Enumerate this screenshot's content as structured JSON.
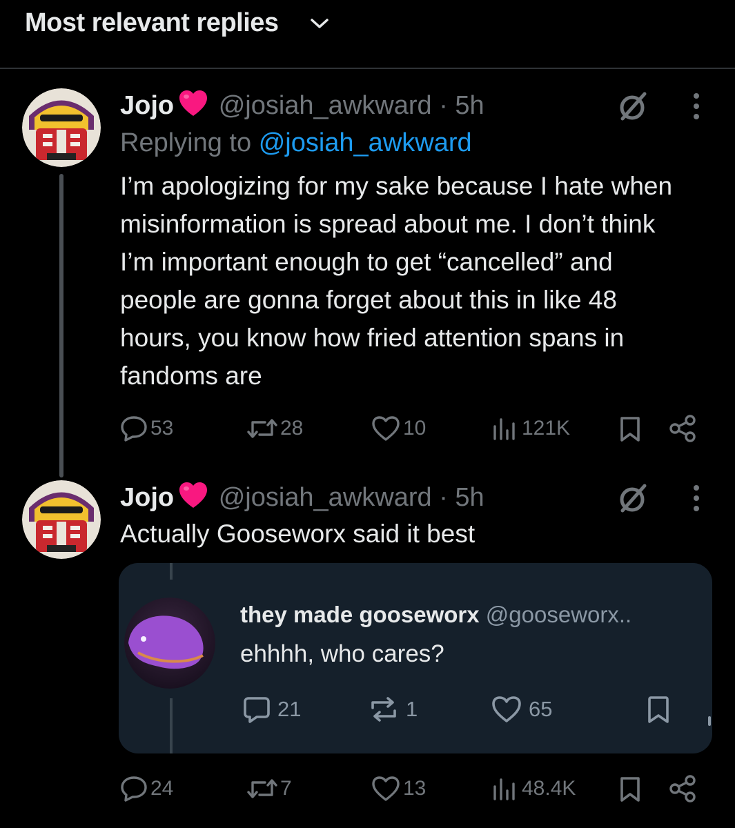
{
  "header": {
    "title": "Most relevant replies",
    "dropdown_icon": "chevron-down-icon"
  },
  "colors": {
    "background": "#000000",
    "text": "#e7e9ea",
    "muted": "#71767b",
    "link": "#1d9bf0",
    "heart": "#f91880",
    "quote_bg": "#15202b"
  },
  "tweets": [
    {
      "name": "Jojo",
      "handle": "@josiah_awkward",
      "separator": "·",
      "time": "5h",
      "replying_prefix": "Replying to",
      "replying_to": "@josiah_awkward",
      "text": "I’m apologizing for my sake because I hate when misinformation is spread about me. I don’t think I’m important enough to get “cancelled” and people are gonna forget about this in like 48 hours, you know how fried attention spans in fandoms are",
      "actions": {
        "replies": "53",
        "reposts": "28",
        "likes": "10",
        "views": "121K"
      }
    },
    {
      "name": "Jojo",
      "handle": "@josiah_awkward",
      "separator": "·",
      "time": "5h",
      "text": "Actually Gooseworx said it best",
      "actions": {
        "replies": "24",
        "reposts": "7",
        "likes": "13",
        "views": "48.4K"
      }
    }
  ],
  "quote": {
    "name": "they made gooseworx",
    "handle": "@gooseworx..",
    "text": "ehhhh, who cares?",
    "actions": {
      "replies": "21",
      "reposts": "1",
      "likes": "65"
    }
  }
}
